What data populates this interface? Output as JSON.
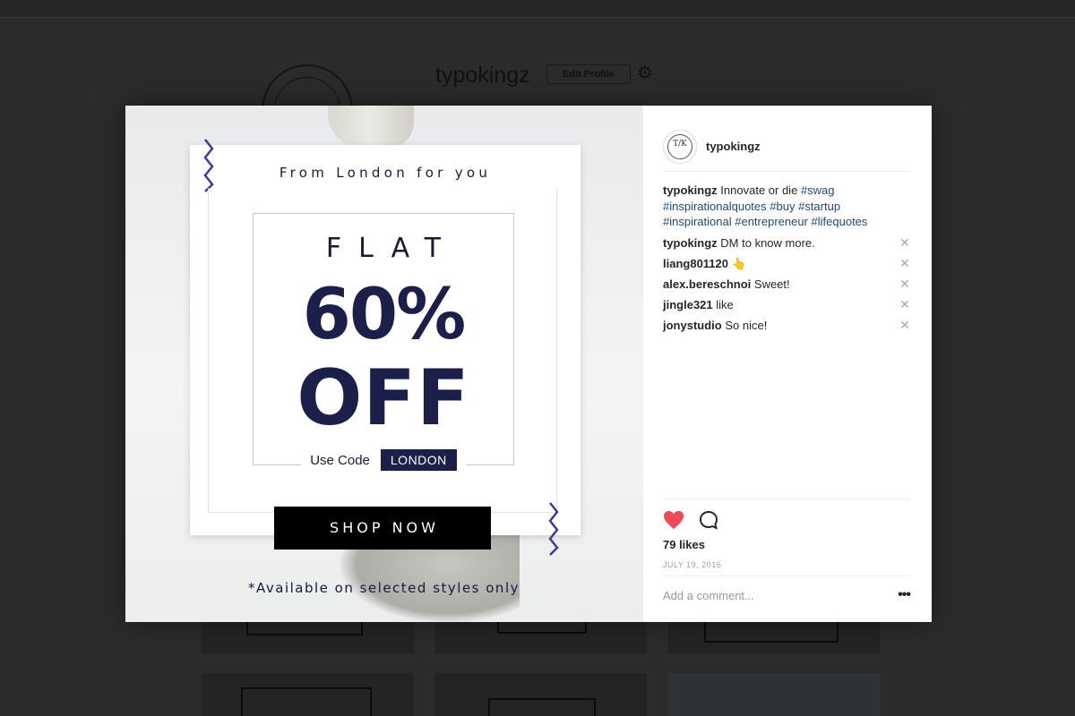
{
  "background": {
    "username": "typokingz",
    "edit_profile_label": "Edit Profile",
    "settings_icon": "gear-icon"
  },
  "post": {
    "headline": "From London for you",
    "flat_label": "FLAT",
    "discount": "60%",
    "off_label": "OFF",
    "use_code_label": "Use Code",
    "code": "LONDON",
    "shop_button": "SHOP NOW",
    "disclaimer": "*Available on selected styles only",
    "accent_color": "#1c1f4a",
    "zigzag_color": "#3d3a9a"
  },
  "side": {
    "username": "typokingz",
    "avatar_monogram": "T/K",
    "caption": {
      "user": "typokingz",
      "text": "Innovate or die",
      "tags": [
        "#swag",
        "#inspirationalquotes",
        "#buy",
        "#startup",
        "#inspirational",
        "#entrepreneur",
        "#lifequotes"
      ]
    },
    "comments": [
      {
        "user": "typokingz",
        "text": "DM to know more."
      },
      {
        "user": "liang801120",
        "text": "👆"
      },
      {
        "user": "alex.bereschnoi",
        "text": "Sweet!"
      },
      {
        "user": "jingle321",
        "text": "like"
      },
      {
        "user": "jonystudio",
        "text": "So nice!"
      }
    ],
    "likes": "79 likes",
    "date": "JULY 19, 2016",
    "comment_placeholder": "Add a comment...",
    "more_label": "•••",
    "heart_color": "#ed4956"
  }
}
